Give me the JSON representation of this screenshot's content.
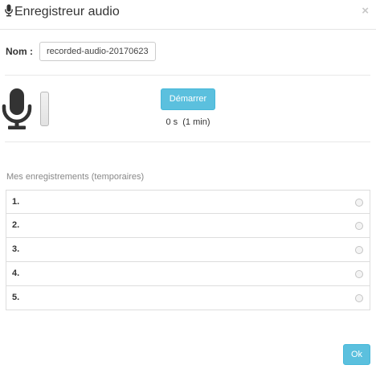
{
  "dialog": {
    "title": "Enregistreur audio",
    "title_icon": "microphone-icon",
    "close_label": "×"
  },
  "name_field": {
    "label": "Nom :",
    "value": "recorded-audio-20170623"
  },
  "recorder": {
    "mic_icon": "microphone-icon",
    "start_label": "Démarrer",
    "time_text": "0 s  (1 min)",
    "level": 0
  },
  "recordings": {
    "heading": "Mes enregistrements (temporaires)",
    "items": [
      {
        "number": "1."
      },
      {
        "number": "2."
      },
      {
        "number": "3."
      },
      {
        "number": "4."
      },
      {
        "number": "5."
      }
    ]
  },
  "footer": {
    "ok_label": "Ok"
  },
  "colors": {
    "accent": "#5bc0de",
    "accent_border": "#46b8da"
  }
}
